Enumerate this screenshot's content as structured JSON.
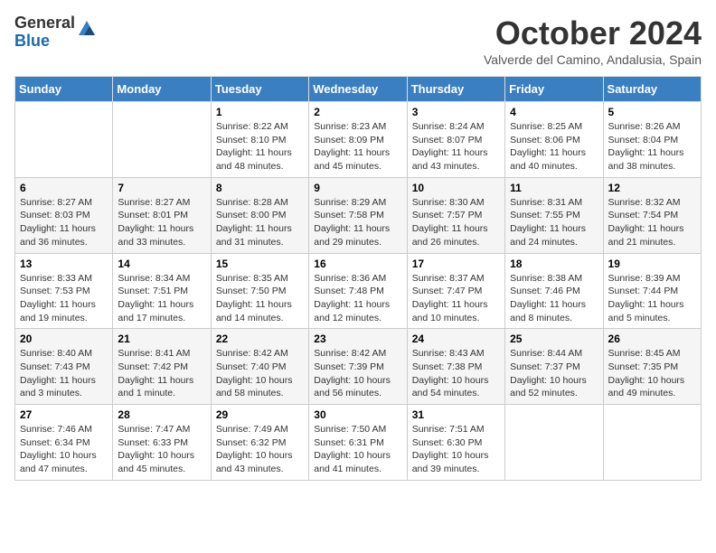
{
  "header": {
    "logo_general": "General",
    "logo_blue": "Blue",
    "month": "October 2024",
    "location": "Valverde del Camino, Andalusia, Spain"
  },
  "days_of_week": [
    "Sunday",
    "Monday",
    "Tuesday",
    "Wednesday",
    "Thursday",
    "Friday",
    "Saturday"
  ],
  "weeks": [
    [
      {
        "day": "",
        "info": ""
      },
      {
        "day": "",
        "info": ""
      },
      {
        "day": "1",
        "info": "Sunrise: 8:22 AM\nSunset: 8:10 PM\nDaylight: 11 hours and 48 minutes."
      },
      {
        "day": "2",
        "info": "Sunrise: 8:23 AM\nSunset: 8:09 PM\nDaylight: 11 hours and 45 minutes."
      },
      {
        "day": "3",
        "info": "Sunrise: 8:24 AM\nSunset: 8:07 PM\nDaylight: 11 hours and 43 minutes."
      },
      {
        "day": "4",
        "info": "Sunrise: 8:25 AM\nSunset: 8:06 PM\nDaylight: 11 hours and 40 minutes."
      },
      {
        "day": "5",
        "info": "Sunrise: 8:26 AM\nSunset: 8:04 PM\nDaylight: 11 hours and 38 minutes."
      }
    ],
    [
      {
        "day": "6",
        "info": "Sunrise: 8:27 AM\nSunset: 8:03 PM\nDaylight: 11 hours and 36 minutes."
      },
      {
        "day": "7",
        "info": "Sunrise: 8:27 AM\nSunset: 8:01 PM\nDaylight: 11 hours and 33 minutes."
      },
      {
        "day": "8",
        "info": "Sunrise: 8:28 AM\nSunset: 8:00 PM\nDaylight: 11 hours and 31 minutes."
      },
      {
        "day": "9",
        "info": "Sunrise: 8:29 AM\nSunset: 7:58 PM\nDaylight: 11 hours and 29 minutes."
      },
      {
        "day": "10",
        "info": "Sunrise: 8:30 AM\nSunset: 7:57 PM\nDaylight: 11 hours and 26 minutes."
      },
      {
        "day": "11",
        "info": "Sunrise: 8:31 AM\nSunset: 7:55 PM\nDaylight: 11 hours and 24 minutes."
      },
      {
        "day": "12",
        "info": "Sunrise: 8:32 AM\nSunset: 7:54 PM\nDaylight: 11 hours and 21 minutes."
      }
    ],
    [
      {
        "day": "13",
        "info": "Sunrise: 8:33 AM\nSunset: 7:53 PM\nDaylight: 11 hours and 19 minutes."
      },
      {
        "day": "14",
        "info": "Sunrise: 8:34 AM\nSunset: 7:51 PM\nDaylight: 11 hours and 17 minutes."
      },
      {
        "day": "15",
        "info": "Sunrise: 8:35 AM\nSunset: 7:50 PM\nDaylight: 11 hours and 14 minutes."
      },
      {
        "day": "16",
        "info": "Sunrise: 8:36 AM\nSunset: 7:48 PM\nDaylight: 11 hours and 12 minutes."
      },
      {
        "day": "17",
        "info": "Sunrise: 8:37 AM\nSunset: 7:47 PM\nDaylight: 11 hours and 10 minutes."
      },
      {
        "day": "18",
        "info": "Sunrise: 8:38 AM\nSunset: 7:46 PM\nDaylight: 11 hours and 8 minutes."
      },
      {
        "day": "19",
        "info": "Sunrise: 8:39 AM\nSunset: 7:44 PM\nDaylight: 11 hours and 5 minutes."
      }
    ],
    [
      {
        "day": "20",
        "info": "Sunrise: 8:40 AM\nSunset: 7:43 PM\nDaylight: 11 hours and 3 minutes."
      },
      {
        "day": "21",
        "info": "Sunrise: 8:41 AM\nSunset: 7:42 PM\nDaylight: 11 hours and 1 minute."
      },
      {
        "day": "22",
        "info": "Sunrise: 8:42 AM\nSunset: 7:40 PM\nDaylight: 10 hours and 58 minutes."
      },
      {
        "day": "23",
        "info": "Sunrise: 8:42 AM\nSunset: 7:39 PM\nDaylight: 10 hours and 56 minutes."
      },
      {
        "day": "24",
        "info": "Sunrise: 8:43 AM\nSunset: 7:38 PM\nDaylight: 10 hours and 54 minutes."
      },
      {
        "day": "25",
        "info": "Sunrise: 8:44 AM\nSunset: 7:37 PM\nDaylight: 10 hours and 52 minutes."
      },
      {
        "day": "26",
        "info": "Sunrise: 8:45 AM\nSunset: 7:35 PM\nDaylight: 10 hours and 49 minutes."
      }
    ],
    [
      {
        "day": "27",
        "info": "Sunrise: 7:46 AM\nSunset: 6:34 PM\nDaylight: 10 hours and 47 minutes."
      },
      {
        "day": "28",
        "info": "Sunrise: 7:47 AM\nSunset: 6:33 PM\nDaylight: 10 hours and 45 minutes."
      },
      {
        "day": "29",
        "info": "Sunrise: 7:49 AM\nSunset: 6:32 PM\nDaylight: 10 hours and 43 minutes."
      },
      {
        "day": "30",
        "info": "Sunrise: 7:50 AM\nSunset: 6:31 PM\nDaylight: 10 hours and 41 minutes."
      },
      {
        "day": "31",
        "info": "Sunrise: 7:51 AM\nSunset: 6:30 PM\nDaylight: 10 hours and 39 minutes."
      },
      {
        "day": "",
        "info": ""
      },
      {
        "day": "",
        "info": ""
      }
    ]
  ]
}
